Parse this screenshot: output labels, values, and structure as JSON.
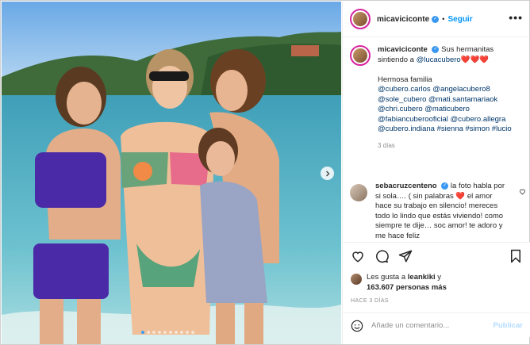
{
  "post": {
    "username": "micaviciconte",
    "separator": "•",
    "follow_label": "Seguir",
    "more_label": "•••"
  },
  "caption": {
    "username": "micaviciconte",
    "intro": "Sus hermanitas sintiendo a",
    "intro_mention": "@lucacubero",
    "intro_hearts": "❤️❤️❤️",
    "body_line": "Hermosa familia",
    "tags": "@cubero.carlos @angelacubero8 @sole_cubero @mati.santamariaok @chri.cubero @maticubero @fabiancuberooficial @cubero.allegra @cubero.indiana #sienna #simon #lucio",
    "time": "3 días"
  },
  "comment": {
    "username": "sebacruzcenteno",
    "text_a": "la foto habla por si sola…. ( sin palabras",
    "text_heart": "❤️",
    "text_b": "el amor hace su trabajo en silencio! mereces todo lo lindo que estás viviendo! como siempre te dije…",
    "text_c": "soc amor! te adoro y me hace feliz"
  },
  "likes": {
    "prefix": "Les gusta a",
    "user": "leankiki",
    "joiner": "y",
    "count": "163.607 personas más"
  },
  "ago": "HACE 3 DÍAS",
  "add_comment": {
    "placeholder": "Añade un comentario...",
    "publish_label": "Publicar"
  },
  "icons": {
    "like": "heart-icon",
    "comment": "comment-icon",
    "share": "share-icon",
    "save": "bookmark-icon",
    "emoji": "emoji-icon",
    "next": "chevron-right-icon"
  },
  "carousel": {
    "count": 10,
    "active_index": 0
  },
  "colors": {
    "accent": "#0095f6",
    "verified": "#3897f0",
    "mention": "#00376b",
    "heart": "#e0245e",
    "story_ring": "#d6249f"
  }
}
